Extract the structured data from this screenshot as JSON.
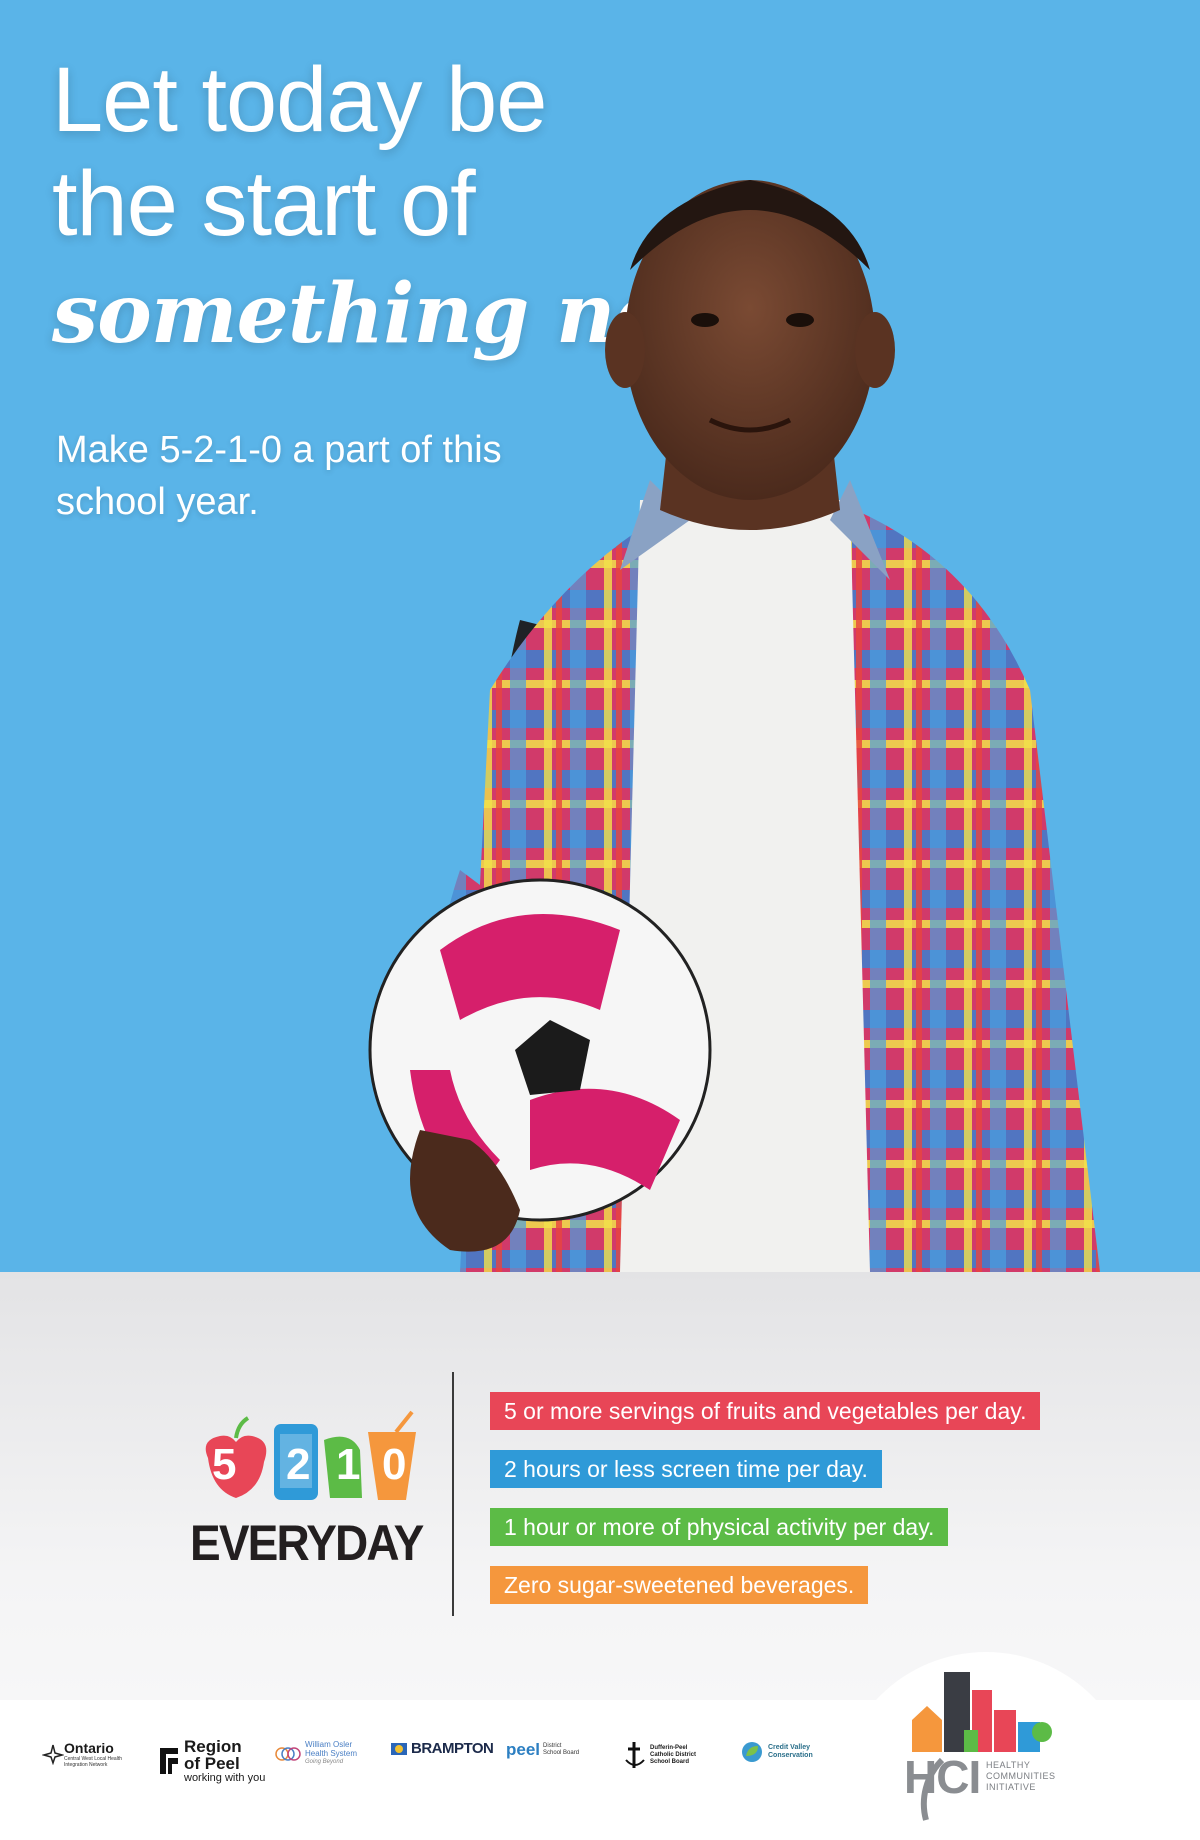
{
  "hero": {
    "headline_line1": "Let today be",
    "headline_line2": "the start of",
    "headline_script": "something new!",
    "subline": "Make 5-2-1-0 a part of this school year."
  },
  "program": {
    "logo_digits": [
      "5",
      "2",
      "1",
      "0"
    ],
    "tagline": "EVERYDAY",
    "habits": [
      {
        "text": "5 or more servings of fruits and vegetables per day.",
        "color": "#e84657"
      },
      {
        "text": "2 hours or less screen time per day.",
        "color": "#2f9ad8"
      },
      {
        "text": "1 hour or more of physical activity per day.",
        "color": "#5cbb46"
      },
      {
        "text": "Zero sugar-sweetened beverages.",
        "color": "#f5973d"
      }
    ]
  },
  "partners": {
    "ontario": {
      "name": "Ontario",
      "sub": "Central West Local Health Integration Network"
    },
    "peel": {
      "name_line1": "Region",
      "name_line2": "of Peel",
      "sub": "working with you"
    },
    "osler": {
      "name_line1": "William Osler",
      "name_line2": "Health System",
      "sub": "Going Beyond"
    },
    "brampton": {
      "name": "BRAMPTON"
    },
    "pdsb": {
      "name": "peel",
      "sub_line1": "District",
      "sub_line2": "School Board"
    },
    "dpcdsb": {
      "line1": "Dufferin-Peel",
      "line2": "Catholic District",
      "line3": "School Board"
    },
    "cvc": {
      "line1": "Credit Valley",
      "line2": "Conservation"
    },
    "hci": {
      "abbr": "HCI",
      "line1": "HEALTHY",
      "line2": "COMMUNITIES",
      "line3": "INITIATIVE"
    }
  },
  "colors": {
    "hero_bg": "#5ab4e8",
    "red": "#e84657",
    "blue": "#2f9ad8",
    "green": "#5cbb46",
    "orange": "#f5973d"
  }
}
